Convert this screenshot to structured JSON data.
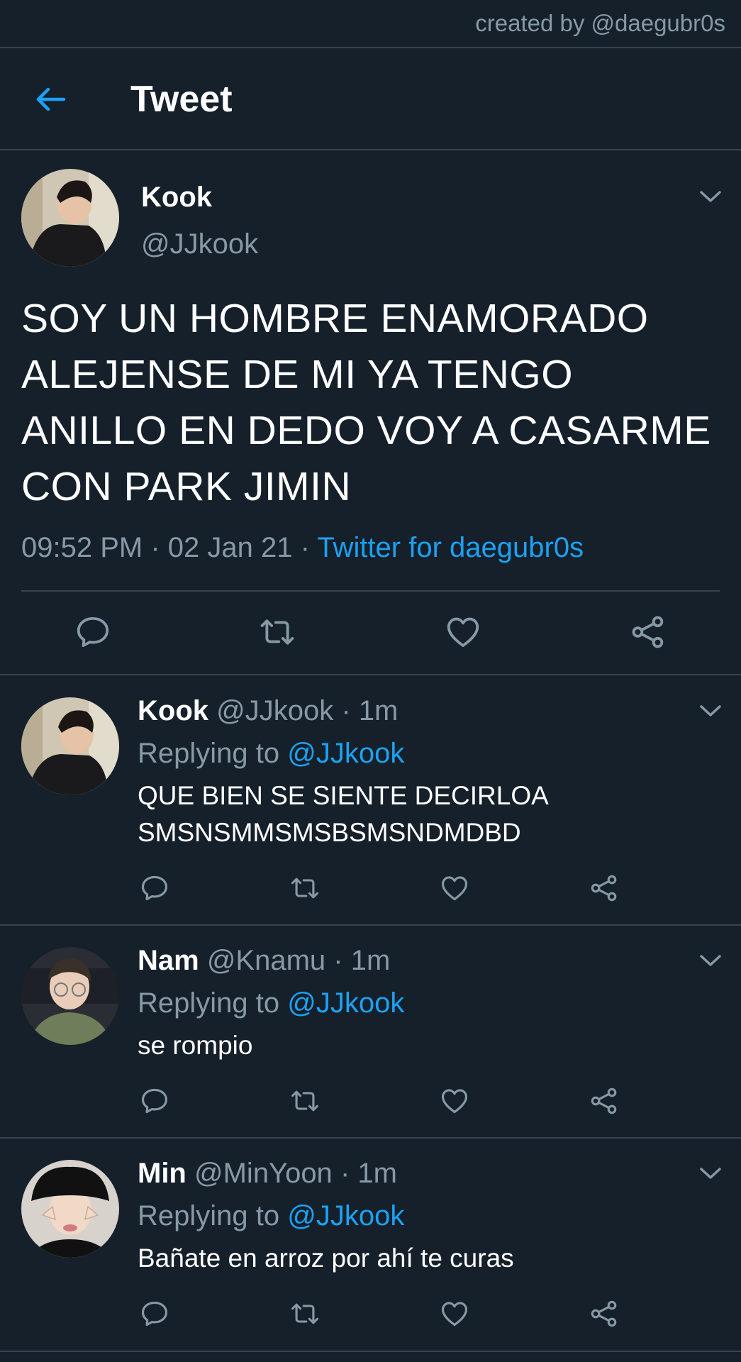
{
  "credit": "created by @daegubr0s",
  "header": {
    "title": "Tweet"
  },
  "tweet": {
    "name": "Kook",
    "handle": "@JJkook",
    "text": "SOY UN HOMBRE ENAMORADO ALEJENSE DE MI YA TENGO ANILLO EN DEDO VOY A CASARME CON PARK JIMIN",
    "time": "09:52 PM",
    "date": "02 Jan 21",
    "source": "Twitter for daegubr0s"
  },
  "replies": [
    {
      "name": "Kook",
      "handle": "@JJkook",
      "time": "1m",
      "replying_label": "Replying to",
      "replying_to": "@JJkook",
      "text": "QUE BIEN SE SIENTE DECIRLOA SMSNSMMSMSBSMSNDMDBD"
    },
    {
      "name": "Nam",
      "handle": "@Knamu",
      "time": "1m",
      "replying_label": "Replying to",
      "replying_to": "@JJkook",
      "text": "se rompio"
    },
    {
      "name": "Min",
      "handle": "@MinYoon",
      "time": "1m",
      "replying_label": "Replying to",
      "replying_to": "@JJkook",
      "text": "Bañate en arroz por ahí te curas"
    }
  ],
  "colors": {
    "background": "#15202b",
    "accent": "#1da1f2",
    "secondary_text": "#8899a6",
    "divider": "#38444d"
  },
  "icons": [
    "back-arrow-icon",
    "chevron-down-icon",
    "reply-icon",
    "retweet-icon",
    "like-icon",
    "share-icon"
  ]
}
